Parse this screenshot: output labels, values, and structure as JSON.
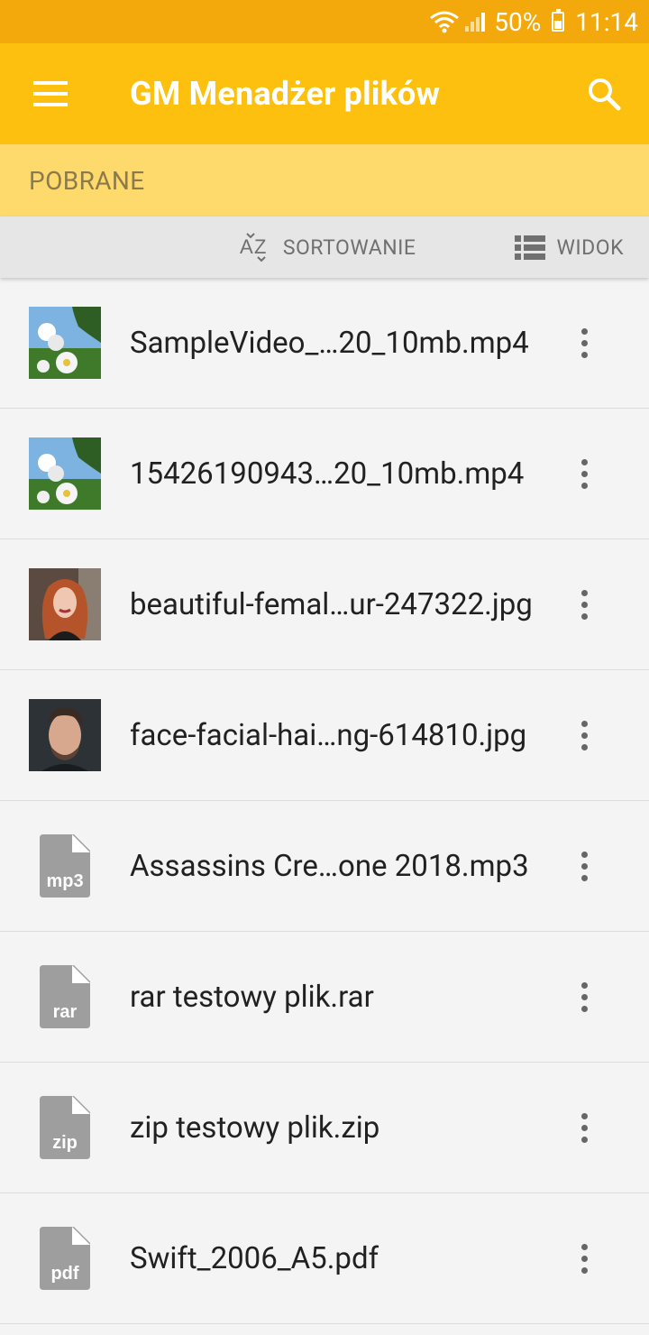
{
  "status_bar": {
    "battery": "50%",
    "time": "11:14"
  },
  "app_bar": {
    "title": "GM Menadżer plików",
    "icons": [
      "menu-icon",
      "search-icon"
    ]
  },
  "breadcrumb": {
    "current": "POBRANE"
  },
  "toolbar": {
    "sort_label": "SORTOWANIE",
    "view_label": "WIDOK"
  },
  "files": [
    {
      "name": "SampleVideo_…20_10mb.mp4",
      "thumb": "video-thumb"
    },
    {
      "name": "15426190943…20_10mb.mp4",
      "thumb": "video-thumb"
    },
    {
      "name": "beautiful-femal…ur-247322.jpg",
      "thumb": "photo-woman"
    },
    {
      "name": "face-facial-hai…ng-614810.jpg",
      "thumb": "photo-man"
    },
    {
      "name": "Assassins Cre…one 2018.mp3",
      "thumb": "file-icon",
      "ext": "mp3"
    },
    {
      "name": "rar testowy plik.rar",
      "thumb": "file-icon",
      "ext": "rar"
    },
    {
      "name": "zip testowy plik.zip",
      "thumb": "file-icon",
      "ext": "zip"
    },
    {
      "name": "Swift_2006_A5.pdf",
      "thumb": "file-icon",
      "ext": "pdf"
    }
  ],
  "colors": {
    "status_bar": "#f3a90b",
    "app_bar": "#fdc00e",
    "breadcrumb_bar": "#fed96c",
    "toolbar": "#e6e6e6",
    "list_bg": "#f4f4f4",
    "file_icon": "#9e9e9e"
  }
}
